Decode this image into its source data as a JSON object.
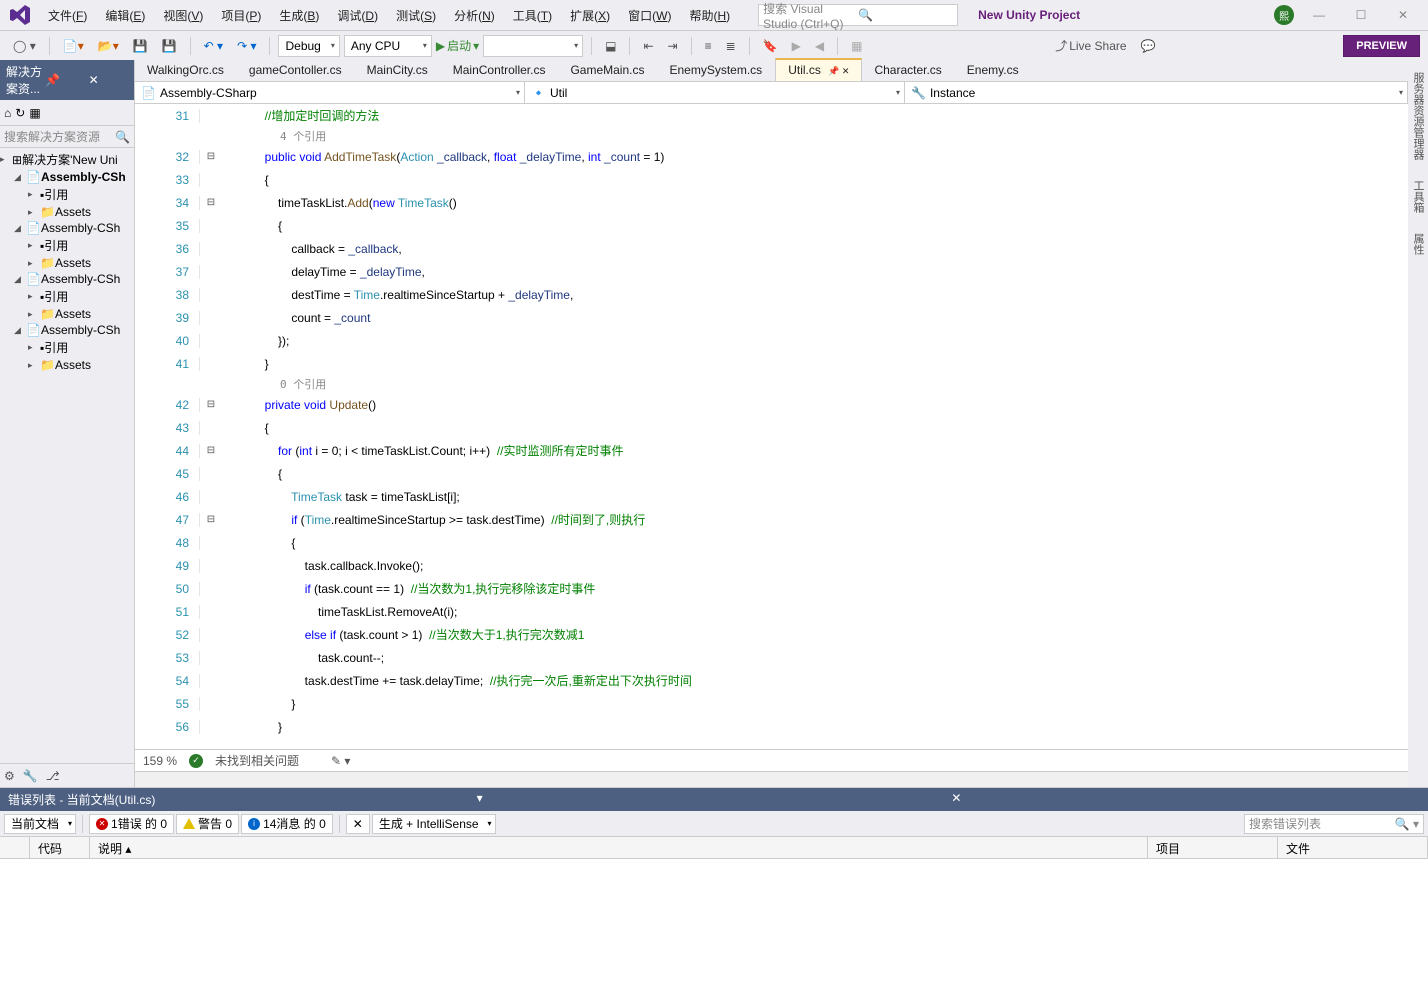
{
  "menu": [
    "文件(F)",
    "编辑(E)",
    "视图(V)",
    "项目(P)",
    "生成(B)",
    "调试(D)",
    "测试(S)",
    "分析(N)",
    "工具(T)",
    "扩展(X)",
    "窗口(W)",
    "帮助(H)"
  ],
  "menu_keys": [
    "F",
    "E",
    "V",
    "P",
    "B",
    "D",
    "S",
    "N",
    "T",
    "X",
    "W",
    "H"
  ],
  "search_placeholder": "搜索 Visual Studio (Ctrl+Q)",
  "project_name": "New Unity Project",
  "badge_letter": "熙",
  "live_share": "Live Share",
  "preview": "PREVIEW",
  "toolbar": {
    "debug": "Debug",
    "cpu": "Any CPU",
    "start": "启动"
  },
  "solution": {
    "title": "解决方案资...",
    "search": "搜索解决方案资源",
    "root": "解决方案'New Uni",
    "nodes": [
      {
        "label": "Assembly-CSh",
        "bold": true
      },
      {
        "label": "Assembly-CSh",
        "bold": false
      },
      {
        "label": "Assembly-CSh",
        "bold": false
      },
      {
        "label": "Assembly-CSh",
        "bold": false
      }
    ],
    "child_refs": "引用",
    "child_assets": "Assets"
  },
  "tabs": [
    "WalkingOrc.cs",
    "gameContoller.cs",
    "MainCity.cs",
    "MainController.cs",
    "GameMain.cs",
    "EnemySystem.cs",
    "Util.cs",
    "Character.cs",
    "Enemy.cs"
  ],
  "active_tab": 6,
  "nav": {
    "left": "Assembly-CSharp",
    "mid": "Util",
    "right": "Instance"
  },
  "zoom": "159 %",
  "no_issues": "未找到相关问题",
  "refs": {
    "r1": "4 个引用",
    "r2": "0 个引用"
  },
  "code": {
    "l31": "//增加定时回调的方法",
    "l32": [
      "public",
      "void",
      "AddTimeTask",
      "(",
      "Action",
      "_callback",
      ", ",
      "float",
      "_delayTime",
      ", ",
      "int",
      "_count",
      " = 1)"
    ],
    "l33": "{",
    "l34": [
      "    timeTaskList.",
      "Add",
      "(",
      "new",
      "TimeTask",
      "()"
    ],
    "l35": "    {",
    "l36": [
      "        callback = ",
      "_callback",
      ","
    ],
    "l37": [
      "        delayTime = ",
      "_delayTime",
      ","
    ],
    "l38": [
      "        destTime = ",
      "Time",
      ".realtimeSinceStartup + ",
      "_delayTime",
      ","
    ],
    "l39": [
      "        count = ",
      "_count"
    ],
    "l40": "    });",
    "l41": "}",
    "l42": [
      "private",
      "void",
      "Update",
      "()"
    ],
    "l43": "{",
    "l44": [
      "    ",
      "for",
      " (",
      "int",
      " i = 0; i < timeTaskList.Count; i++)  ",
      "//实时监测所有定时事件"
    ],
    "l45": "    {",
    "l46": [
      "        ",
      "TimeTask",
      " task = timeTaskList[i];"
    ],
    "l47": [
      "        ",
      "if",
      " (",
      "Time",
      ".realtimeSinceStartup >= task.destTime)  ",
      "//时间到了,则执行"
    ],
    "l48": "        {",
    "l49": "            task.callback.Invoke();",
    "l50": [
      "            ",
      "if",
      " (task.count == 1)  ",
      "//当次数为1,执行完移除该定时事件"
    ],
    "l51": "                timeTaskList.RemoveAt(i);",
    "l52": [
      "            ",
      "else if",
      " (task.count > 1)  ",
      "//当次数大于1,执行完次数减1"
    ],
    "l53": "                task.count--;",
    "l54": [
      "            task.destTime += task.delayTime;  ",
      "//执行完一次后,重新定出下次执行时间"
    ],
    "l55": "        }",
    "l56": "    }"
  },
  "line_numbers": [
    31,
    32,
    33,
    34,
    35,
    36,
    37,
    38,
    39,
    40,
    41,
    42,
    43,
    44,
    45,
    46,
    47,
    48,
    49,
    50,
    51,
    52,
    53,
    54,
    55,
    56
  ],
  "error_panel": {
    "title": "错误列表 - 当前文档(Util.cs)",
    "scope": "当前文档",
    "errors": "1错误 的 0",
    "warnings": "警告 0",
    "messages": "14消息 的 0",
    "build": "生成 + IntelliSense",
    "search": "搜索错误列表",
    "cols": {
      "code": "代码",
      "desc": "说明",
      "project": "项目",
      "file": "文件"
    }
  },
  "right_tabs": [
    "服务器资源管理器",
    "工具箱",
    "属性"
  ]
}
